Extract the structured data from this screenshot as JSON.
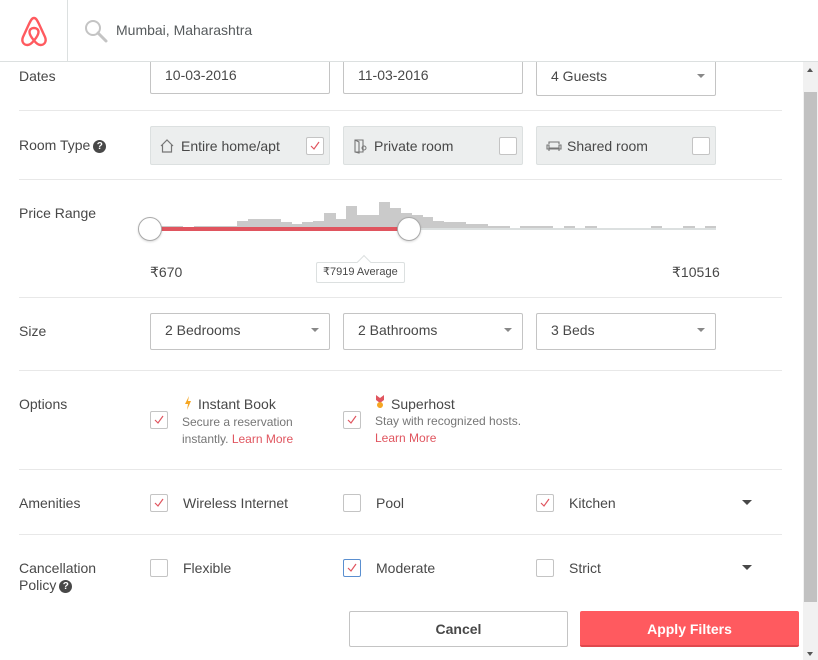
{
  "header": {
    "search_value": "Mumbai, Maharashtra",
    "brand_color": "#ff5a5f"
  },
  "dates": {
    "label": "Dates",
    "checkin": "10-03-2016",
    "checkout": "11-03-2016",
    "guests": "4 Guests"
  },
  "room_type": {
    "label": "Room Type",
    "help": "?",
    "options": [
      {
        "label": "Entire home/apt",
        "icon": "home-icon",
        "checked": true
      },
      {
        "label": "Private room",
        "icon": "door-icon",
        "checked": false
      },
      {
        "label": "Shared room",
        "icon": "couch-icon",
        "checked": false
      }
    ]
  },
  "price_range": {
    "label": "Price Range",
    "min_label": "₹670",
    "max_label": "₹10516",
    "average_label": "₹7919 Average",
    "min_value": 670,
    "max_value": 10516,
    "selected_low": 670,
    "selected_high": 5170,
    "histogram": [
      0.5,
      0.5,
      0.5,
      0,
      1,
      1,
      0.5,
      0.5,
      4,
      5,
      5,
      5,
      3,
      2,
      3,
      4,
      8,
      5,
      12,
      7,
      7,
      14,
      11,
      8,
      7,
      6,
      4,
      3,
      3,
      2,
      2,
      1,
      1,
      0,
      1,
      1,
      1,
      0,
      1,
      0,
      1,
      0,
      0,
      0,
      0,
      0,
      1,
      0,
      0,
      1,
      0,
      1
    ]
  },
  "size": {
    "label": "Size",
    "bedrooms": "2 Bedrooms",
    "bathrooms": "2 Bathrooms",
    "beds": "3 Beds"
  },
  "options": {
    "label": "Options",
    "instant_book": {
      "title": "Instant Book",
      "desc": "Secure a reservation instantly.",
      "link": "Learn More",
      "checked": true
    },
    "superhost": {
      "title": "Superhost",
      "desc": "Stay with recognized hosts.",
      "link": "Learn More",
      "checked": true
    }
  },
  "amenities": {
    "label": "Amenities",
    "items": [
      {
        "label": "Wireless Internet",
        "checked": true
      },
      {
        "label": "Pool",
        "checked": false
      },
      {
        "label": "Kitchen",
        "checked": true
      }
    ]
  },
  "cancellation": {
    "label_line1": "Cancellation",
    "label_line2": "Policy",
    "help": "?",
    "items": [
      {
        "label": "Flexible",
        "checked": false
      },
      {
        "label": "Moderate",
        "checked": true
      },
      {
        "label": "Strict",
        "checked": false
      }
    ]
  },
  "footer": {
    "cancel": "Cancel",
    "apply": "Apply Filters"
  }
}
